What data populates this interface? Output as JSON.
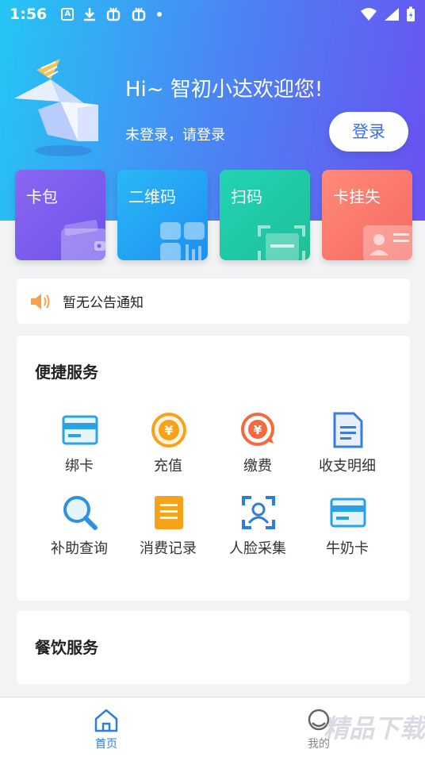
{
  "status_bar": {
    "time": "1:56",
    "icons": [
      "a-box-icon",
      "download-icon",
      "bug-icon",
      "bug-icon",
      "dot-icon"
    ],
    "right_icons": [
      "wifi-icon",
      "signal-icon",
      "battery-icon"
    ]
  },
  "header": {
    "greeting": "Hi~ 智初小达欢迎您!",
    "login_hint": "未登录，请登录",
    "login_button": "登录"
  },
  "quick_cards": [
    {
      "label": "卡包",
      "icon": "wallet-icon",
      "color": "#7a5cf0"
    },
    {
      "label": "二维码",
      "icon": "qr-code-icon",
      "color": "#22a6f4"
    },
    {
      "label": "扫码",
      "icon": "scan-icon",
      "color": "#21c9a6"
    },
    {
      "label": "卡挂失",
      "icon": "id-card-icon",
      "color": "#f77a6e"
    }
  ],
  "notice": {
    "icon": "speaker-icon",
    "text": "暂无公告通知"
  },
  "services": {
    "title": "便捷服务",
    "items": [
      {
        "label": "绑卡",
        "icon": "card-icon"
      },
      {
        "label": "充值",
        "icon": "yuan-coin-icon"
      },
      {
        "label": "缴费",
        "icon": "payment-icon"
      },
      {
        "label": "收支明细",
        "icon": "document-icon"
      },
      {
        "label": "补助查询",
        "icon": "magnifier-icon"
      },
      {
        "label": "消费记录",
        "icon": "list-icon"
      },
      {
        "label": "人脸采集",
        "icon": "face-scan-icon"
      },
      {
        "label": "牛奶卡",
        "icon": "card-icon"
      }
    ]
  },
  "dining": {
    "title": "餐饮服务"
  },
  "tabbar": {
    "home_label": "首页",
    "mine_label": "我的"
  },
  "watermark": {
    "text": "精品下载"
  },
  "colors": {
    "accent": "#2a7de1",
    "hero_start": "#24c6f5",
    "hero_end": "#6a52f2"
  }
}
